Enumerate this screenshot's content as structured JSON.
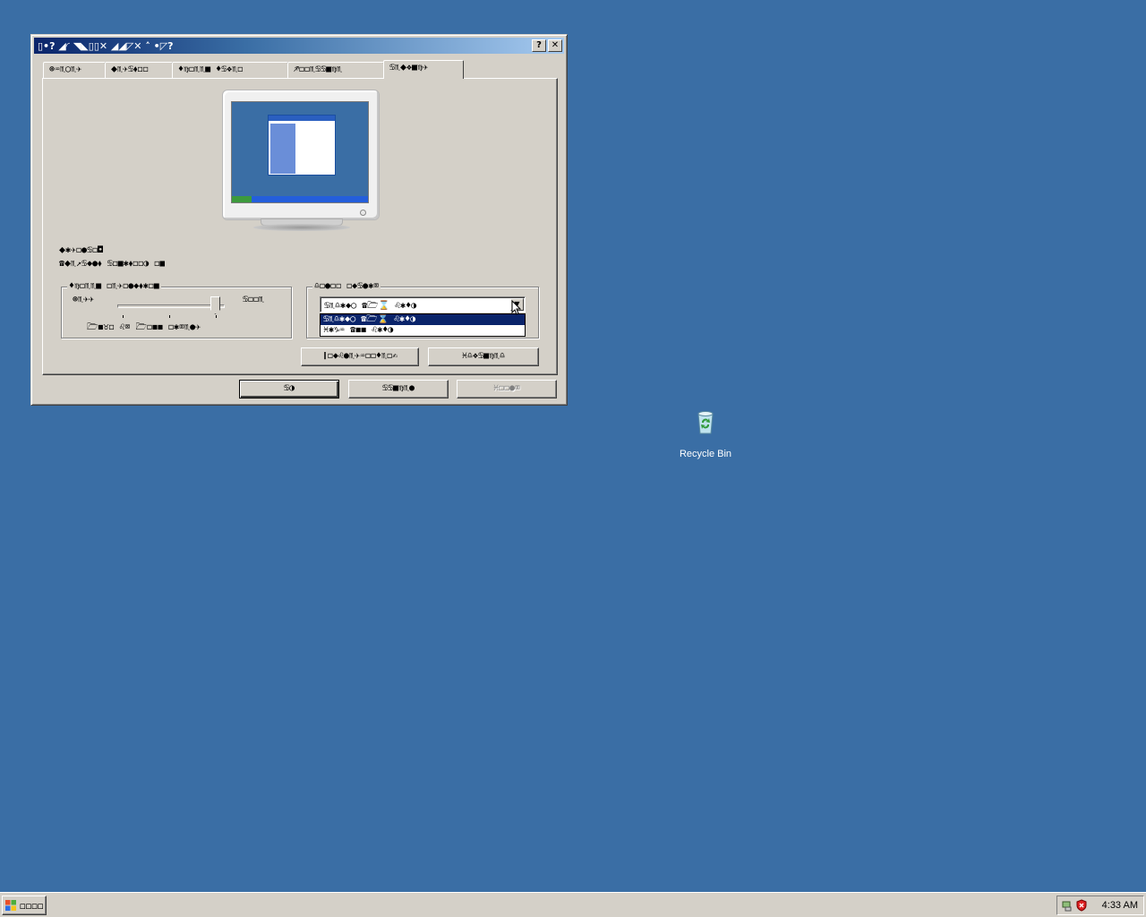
{
  "window": {
    "title": "▯•? ◢◜ ◥◣▯▯✕ ◢◢◸✕ ˄ •◸?",
    "help_btn": "?",
    "close_btn": "✕"
  },
  "tabs": [
    {
      "label": "⊛♒♏◯♏✈"
    },
    {
      "label": "⬥♏✈♋⬧◻◻"
    },
    {
      "label": "♦♍◻♏♏■  ♦♋❖♏◻"
    },
    {
      "label": "♐◻◻♏♋♋■♍♏"
    },
    {
      "label": "♋♏⬥❖■♍✈",
      "active": true
    }
  ],
  "monitor": {
    "icon": "monitor-preview-icon"
  },
  "text_block": {
    "line1": "⬥✱✈◻●♋◻◘",
    "line2": "☎⬥♏↗♋◆●⬧  ♋◻■✱⬧◻◻◑  ◻■"
  },
  "slider_group": {
    "legend": "♦♍◻♏♏■  ◻♏✈◻●◆⬧✱◻■",
    "left_label": "⊛♏✈✈",
    "right_label": "♋◻◻♏",
    "pixels_label": "🗁◼♉◻  ♌⌧  🗁◻◼◼  ◻✱⌧♏●✈"
  },
  "color_group": {
    "legend": "♎◻●◻◻  ◻◆♋●✱⌧",
    "selected": "♋♏♎✱◆◯  ☎🗁⌛  ♌✱♦◑",
    "options": [
      {
        "label": "♋♏♎✱◆◯  ☎🗁⌛  ♌✱♦◑",
        "selected": true
      },
      {
        "label": "♓✱♑♒  ☎◼◼  ♌✱♦◑",
        "selected": false
      }
    ]
  },
  "panel_buttons": {
    "troubleshoot": "❙◻◆♌●♏✈♒◻◻♦♏◻✍",
    "advanced": "♓♎❖♋■♍♏♎"
  },
  "dialog_buttons": {
    "ok": "♋◑",
    "cancel": "♋♋■♍♏●",
    "apply": "♓◻◻●⌧"
  },
  "desktop": {
    "recycle_bin_label": "Recycle Bin"
  },
  "taskbar": {
    "start_label": "◻◻◻◻",
    "clock": "4:33 AM"
  }
}
